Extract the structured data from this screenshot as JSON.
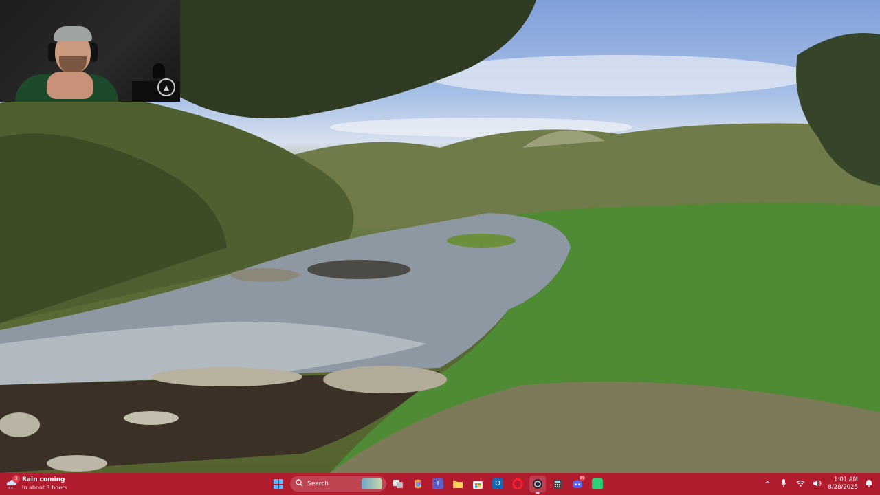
{
  "weather": {
    "badge": "3",
    "title": "Rain coming",
    "subtitle": "In about 3 hours"
  },
  "taskbar": {
    "search_placeholder": "Search",
    "discord_badge": "99",
    "accent": "#b11d2e"
  },
  "tray": {
    "time": "1:01 AM",
    "date": "8/28/2025"
  },
  "icons": {
    "start": "windows-start-icon",
    "search": "search-icon",
    "task_view": "task-view-icon",
    "copilot": "copilot-icon",
    "teams": "teams-icon",
    "explorer": "file-explorer-icon",
    "store": "microsoft-store-icon",
    "outlook": "outlook-icon",
    "opera": "opera-icon",
    "obs": "obs-icon",
    "calculator": "calculator-icon",
    "discord": "discord-icon",
    "xbox": "xbox-icon",
    "chevron_up": "chevron-up-icon",
    "mic": "microphone-icon",
    "wifi": "wifi-icon",
    "volume": "volume-icon",
    "notifications": "notification-bell-icon"
  }
}
